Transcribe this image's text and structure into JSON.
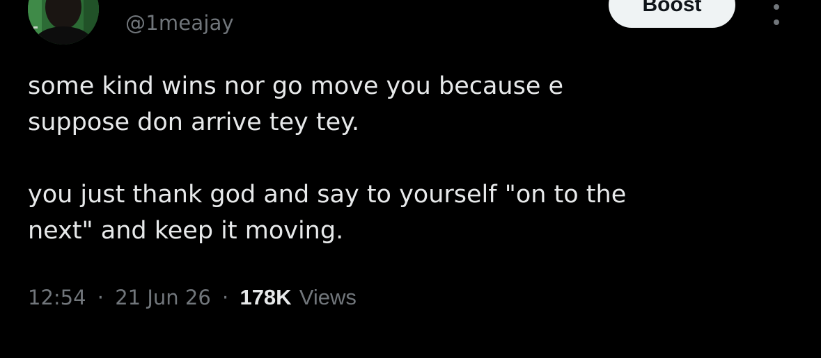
{
  "author": {
    "handle": "@1meajay"
  },
  "actions": {
    "boost_label": "Boost"
  },
  "tweet": {
    "paragraphs": [
      "some kind wins nor go move you because e\nsuppose don arrive tey tey.",
      "you just thank god and say to yourself \"on to the\nnext\" and keep it moving."
    ]
  },
  "meta": {
    "time": "12:54",
    "separator": "·",
    "date": "21 Jun 26",
    "views_count": "178K",
    "views_label": "Views"
  },
  "colors": {
    "background": "#000000",
    "text_primary": "#e7e9ea",
    "text_secondary": "#71767b",
    "button_bg": "#eff3f4"
  },
  "icons": [
    "avatar-image",
    "more-options-icon"
  ]
}
